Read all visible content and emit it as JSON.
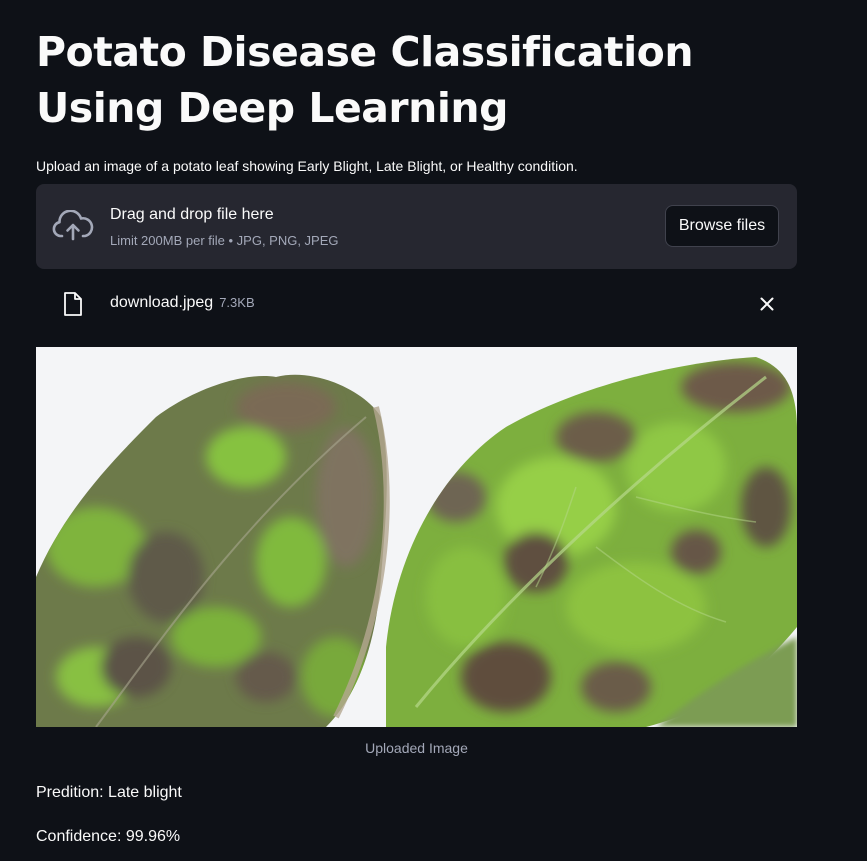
{
  "header": {
    "title": "Potato Disease Classification Using Deep Learning",
    "instructions": "Upload an image of a potato leaf showing Early Blight, Late Blight, or Healthy condition."
  },
  "uploader": {
    "drop_label": "Drag and drop file here",
    "limit_label": "Limit 200MB per file • JPG, PNG, JPEG",
    "browse_label": "Browse files",
    "icon": "cloud-upload-icon"
  },
  "file": {
    "name": "download.jpeg",
    "size": "7.3KB",
    "icon": "file-icon",
    "remove_icon": "close-icon"
  },
  "image": {
    "caption": "Uploaded Image"
  },
  "result": {
    "prediction": "Predition: Late blight",
    "confidence": "Confidence: 99.96%"
  },
  "colors": {
    "background": "#0e1117",
    "panel": "#262730",
    "text": "#fafafa",
    "muted_text": "#a3a8b8"
  }
}
